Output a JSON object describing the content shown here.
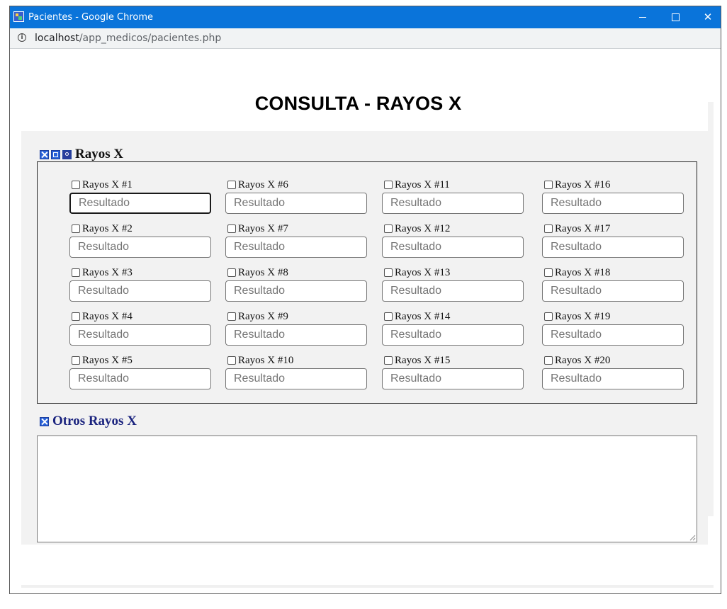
{
  "window": {
    "title": "Pacientes - Google Chrome",
    "url_host": "localhost",
    "url_path": "/app_medicos/pacientes.php",
    "close_glyph": "✕"
  },
  "page": {
    "title": "CONSULTA - RAYOS X"
  },
  "section_rayos": {
    "title": "Rayos X",
    "icons": [
      "close-square-icon",
      "checkbox-square-icon",
      "search-square-icon"
    ]
  },
  "items": [
    {
      "label": "Rayos X #1",
      "placeholder": "Resultado"
    },
    {
      "label": "Rayos X #2",
      "placeholder": "Resultado"
    },
    {
      "label": "Rayos X #3",
      "placeholder": "Resultado"
    },
    {
      "label": "Rayos X #4",
      "placeholder": "Resultado"
    },
    {
      "label": "Rayos X #5",
      "placeholder": "Resultado"
    },
    {
      "label": "Rayos X #6",
      "placeholder": "Resultado"
    },
    {
      "label": "Rayos X #7",
      "placeholder": "Resultado"
    },
    {
      "label": "Rayos X #8",
      "placeholder": "Resultado"
    },
    {
      "label": "Rayos X #9",
      "placeholder": "Resultado"
    },
    {
      "label": "Rayos X #10",
      "placeholder": "Resultado"
    },
    {
      "label": "Rayos X #11",
      "placeholder": "Resultado"
    },
    {
      "label": "Rayos X #12",
      "placeholder": "Resultado"
    },
    {
      "label": "Rayos X #13",
      "placeholder": "Resultado"
    },
    {
      "label": "Rayos X #14",
      "placeholder": "Resultado"
    },
    {
      "label": "Rayos X #15",
      "placeholder": "Resultado"
    },
    {
      "label": "Rayos X #16",
      "placeholder": "Resultado"
    },
    {
      "label": "Rayos X #17",
      "placeholder": "Resultado"
    },
    {
      "label": "Rayos X #18",
      "placeholder": "Resultado"
    },
    {
      "label": "Rayos X #19",
      "placeholder": "Resultado"
    },
    {
      "label": "Rayos X #20",
      "placeholder": "Resultado"
    }
  ],
  "section_otros": {
    "title": "Otros Rayos X",
    "textarea_value": ""
  },
  "colors": {
    "titlebar": "#0a74da",
    "icon_blue": "#2962d8",
    "otros_title": "#1a237e",
    "panel_bg": "#f2f2f2"
  }
}
